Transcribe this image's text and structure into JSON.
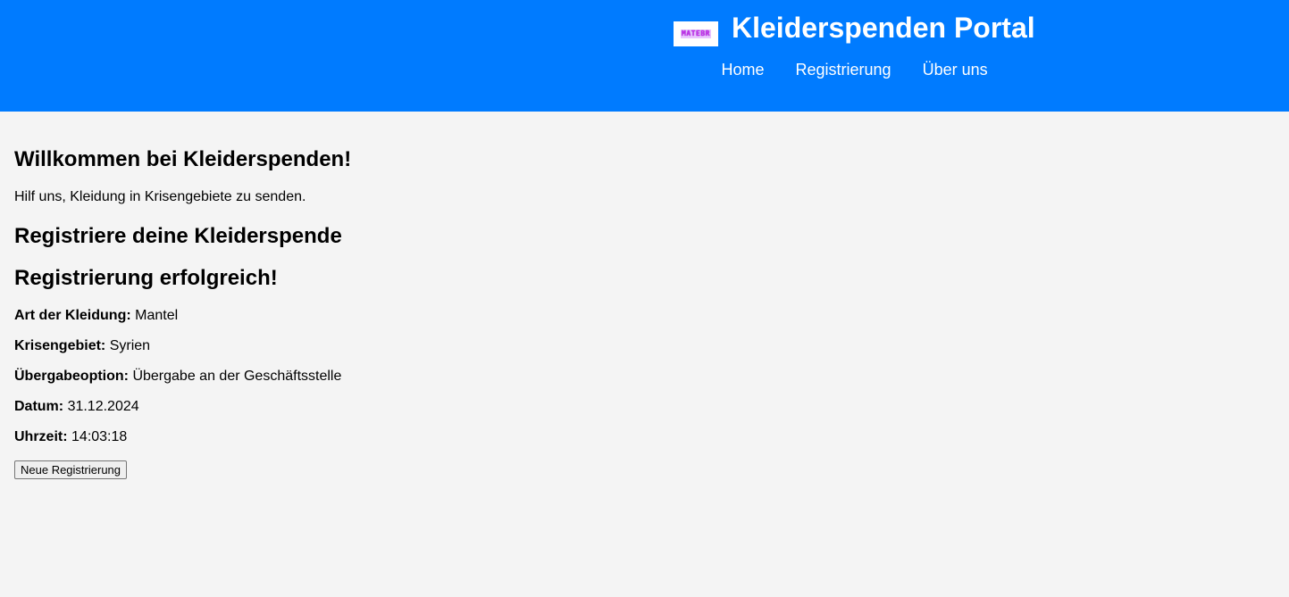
{
  "header": {
    "logo_text": "MATEBR",
    "title": "Kleiderspenden Portal",
    "nav": [
      {
        "label": "Home"
      },
      {
        "label": "Registrierung"
      },
      {
        "label": "Über uns"
      }
    ],
    "background_color": "#007bff"
  },
  "main": {
    "welcome_heading": "Willkommen bei Kleiderspenden!",
    "intro_text": "Hilf uns, Kleidung in Krisengebiete zu senden.",
    "register_heading": "Registriere deine Kleiderspende",
    "success_heading": "Registrierung erfolgreich!",
    "details": [
      {
        "label": "Art der Kleidung:",
        "value": "Mantel"
      },
      {
        "label": "Krisengebiet:",
        "value": "Syrien"
      },
      {
        "label": "Übergabeoption:",
        "value": "Übergabe an der Geschäftsstelle"
      },
      {
        "label": "Datum:",
        "value": "31.12.2024"
      },
      {
        "label": "Uhrzeit:",
        "value": "14:03:18"
      }
    ],
    "new_registration_button": "Neue Registrierung"
  }
}
